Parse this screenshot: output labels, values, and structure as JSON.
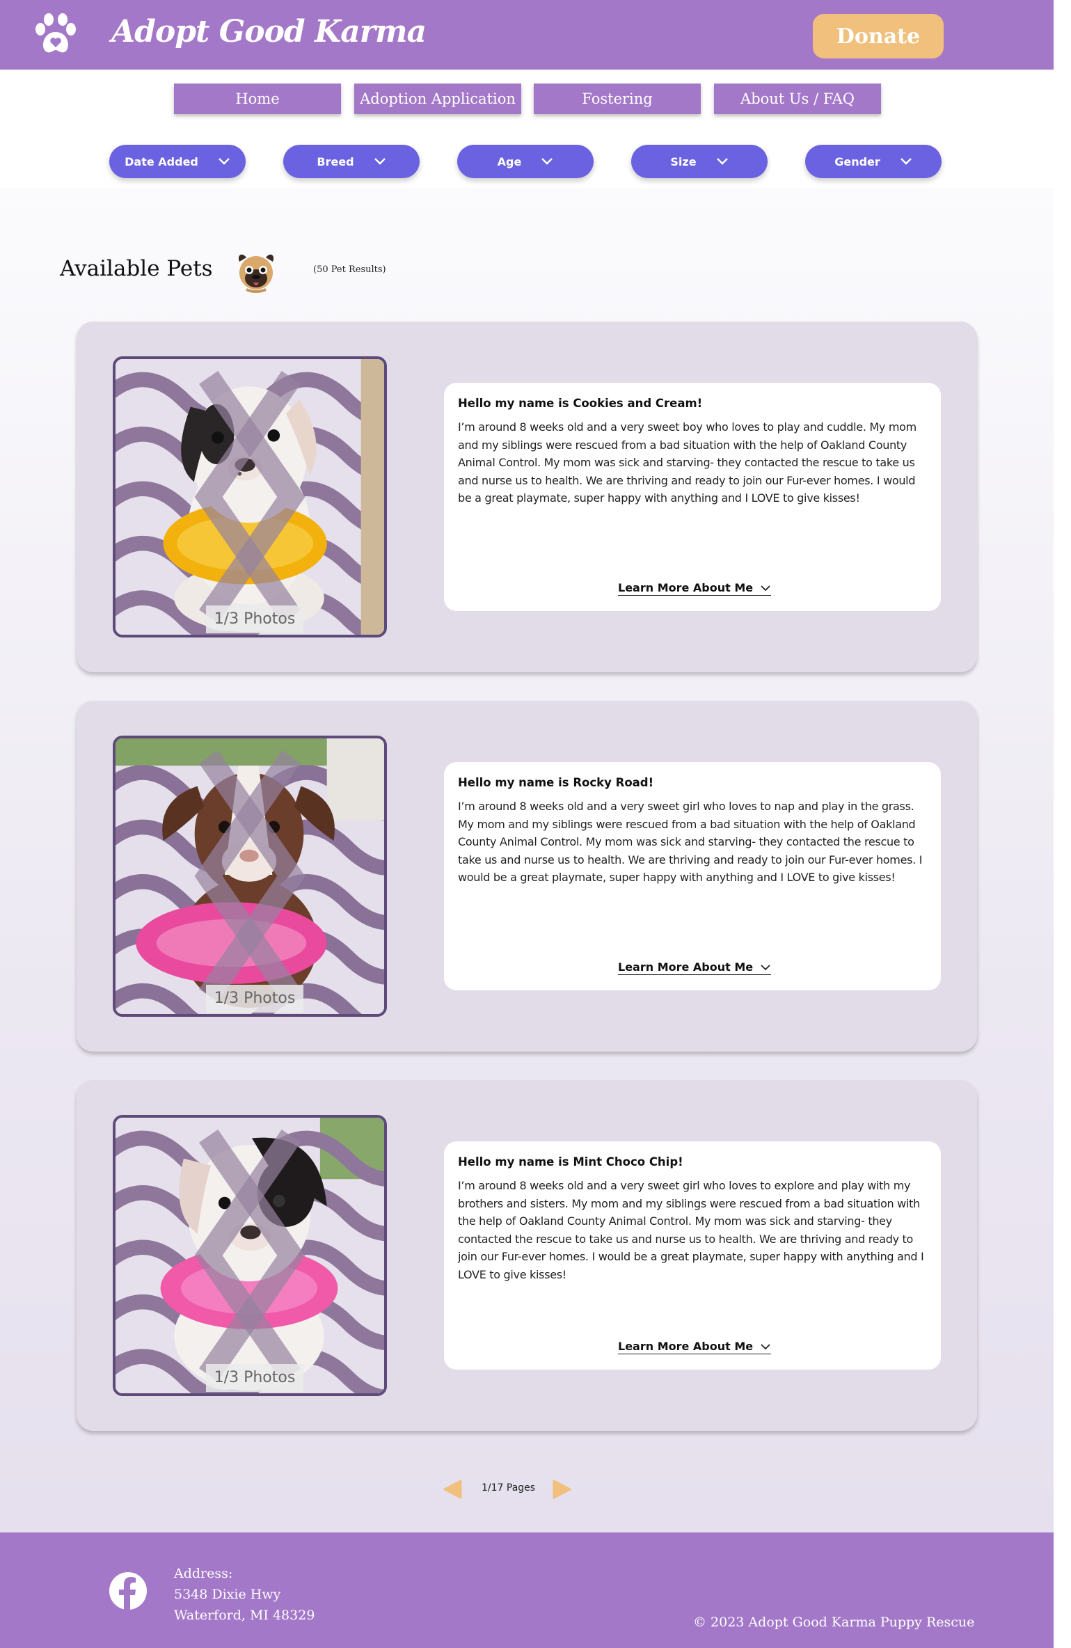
{
  "header": {
    "brand": "Adopt Good Karma",
    "donate_label": "Donate",
    "logo_icon": "paw-heart-icon",
    "brand_color": "#a478c8",
    "donate_color": "#f0c07c"
  },
  "nav": {
    "items": [
      {
        "label": "Home"
      },
      {
        "label": "Adoption Application"
      },
      {
        "label": "Fostering"
      },
      {
        "label": "About Us / FAQ"
      }
    ]
  },
  "filters": {
    "color": "#6a62e0",
    "items": [
      {
        "label": "Date Added"
      },
      {
        "label": "Breed"
      },
      {
        "label": "Age"
      },
      {
        "label": "Size"
      },
      {
        "label": "Gender"
      }
    ]
  },
  "listing": {
    "title": "Available Pets",
    "title_icon": "pug-icon",
    "results": "(50 Pet Results)"
  },
  "pets": [
    {
      "title": "Hello my name is Cookies and Cream!",
      "description": "I’m around 8 weeks old and a very sweet boy who loves to play and cuddle. My mom and my siblings were rescued from a bad situation with the help of Oakland County Animal Control. My mom was sick and starving- they contacted the rescue to take us and nurse us to health. We are thriving and ready to join our Fur-ever homes. I would be a great playmate, super happy with anything and I LOVE to give kisses!",
      "photo_count": "1/3 Photos",
      "learn_more": "Learn More About Me",
      "photo_subject": "white puppy with black eye patch wearing yellow lei",
      "lei_color": "#f2b10c",
      "coat_color": "#f4f0ee",
      "patch_color": "#2a2526"
    },
    {
      "title": "Hello my name is Rocky Road!",
      "description": "I’m around 8 weeks old and a very sweet girl who loves to nap and play in the grass. My mom and my siblings were rescued from a bad situation with the help of Oakland County Animal Control. My mom was sick and starving- they contacted the rescue to take us and nurse us to health. We are thriving and ready to join our Fur-ever homes. I would be a great playmate, super happy with anything and I LOVE to give kisses!",
      "photo_count": "1/3 Photos",
      "learn_more": "Learn More About Me",
      "photo_subject": "brown and white puppy wearing pink lei",
      "lei_color": "#e94a9e",
      "coat_color": "#6b3e2c",
      "patch_color": "#6b3e2c"
    },
    {
      "title": "Hello my name is Mint Choco Chip!",
      "description": "I’m around 8 weeks old and a very sweet girl who loves to explore and play with my brothers and sisters. My mom and my siblings were rescued from a bad situation with the help of Oakland County Animal Control. My mom was sick and starving- they contacted the rescue to take us and nurse us to health. We are thriving and ready to join our Fur-ever homes. I would be a great playmate, super happy with anything and I LOVE to give kisses!",
      "photo_count": "1/3 Photos",
      "learn_more": "Learn More About Me",
      "photo_subject": "white puppy with black ear patch wearing pink lei",
      "lei_color": "#f05aa8",
      "coat_color": "#f4f0ee",
      "patch_color": "#1f1b1c"
    }
  ],
  "pagination": {
    "label": "1/17 Pages",
    "arrow_color": "#f0c07c"
  },
  "footer": {
    "address_label": "Address:",
    "address_line1": "5348 Dixie Hwy",
    "address_line2": "Waterford, MI 48329",
    "copyright": "© 2023 Adopt Good Karma Puppy Rescue",
    "social_icon": "facebook-icon"
  }
}
